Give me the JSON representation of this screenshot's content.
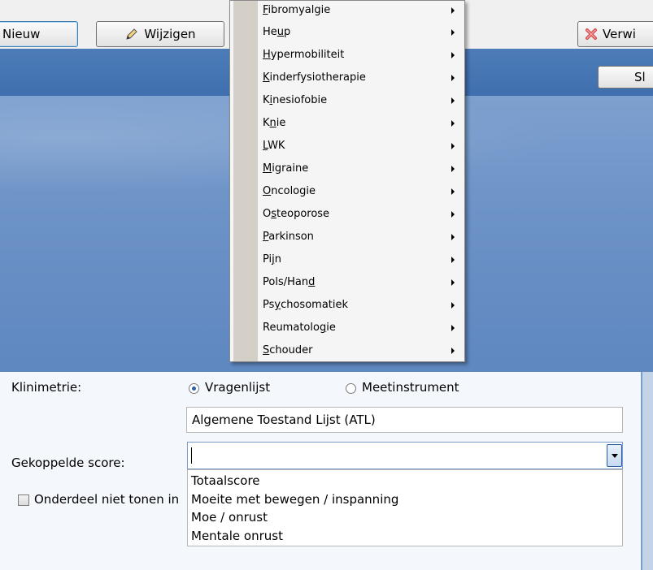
{
  "toolbar": {
    "new_label": "Nieuw",
    "edit_label": "Wijzigen",
    "delete_label": "Verwi",
    "close_label": "Sl"
  },
  "menu": {
    "items": [
      {
        "pre": "",
        "acc": "F",
        "post": "ibromyalgie"
      },
      {
        "pre": "He",
        "acc": "u",
        "post": "p"
      },
      {
        "pre": "",
        "acc": "H",
        "post": "ypermobiliteit"
      },
      {
        "pre": "",
        "acc": "K",
        "post": "inderfysiotherapie"
      },
      {
        "pre": "K",
        "acc": "i",
        "post": "nesiofobie"
      },
      {
        "pre": "K",
        "acc": "n",
        "post": "ie"
      },
      {
        "pre": "",
        "acc": "L",
        "post": "WK"
      },
      {
        "pre": "",
        "acc": "M",
        "post": "igraine"
      },
      {
        "pre": "",
        "acc": "O",
        "post": "ncologie"
      },
      {
        "pre": "O",
        "acc": "s",
        "post": "teoporose"
      },
      {
        "pre": "",
        "acc": "P",
        "post": "arkinson"
      },
      {
        "pre": "Pi",
        "acc": "j",
        "post": "n"
      },
      {
        "pre": "Pols/Han",
        "acc": "d",
        "post": ""
      },
      {
        "pre": "Ps",
        "acc": "y",
        "post": "chosomatiek"
      },
      {
        "pre": "Reumatolo",
        "acc": "g",
        "post": "ie"
      },
      {
        "pre": "",
        "acc": "S",
        "post": "chouder"
      }
    ]
  },
  "form": {
    "klinimetrie_label": "Klinimetrie:",
    "radio_vragenlijst": "Vragenlijst",
    "radio_meetinstrument": "Meetinstrument",
    "questionnaire_value": "Algemene Toestand Lijst (ATL)",
    "gekoppelde_label": "Gekoppelde score:",
    "checkbox_label": "Onderdeel niet tonen in",
    "options": [
      "Totaalscore",
      "Moeite met bewegen / inspanning",
      "Moe / onrust",
      "Mentale onrust"
    ]
  }
}
